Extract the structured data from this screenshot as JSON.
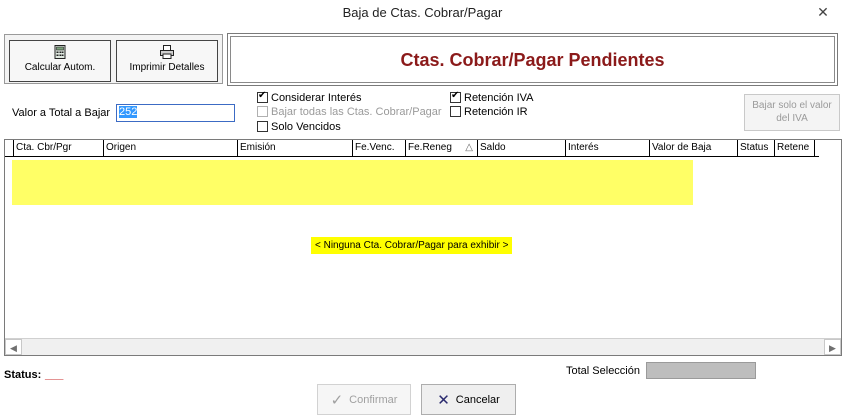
{
  "window": {
    "title": "Baja de Ctas. Cobrar/Pagar",
    "close_glyph": "✕"
  },
  "toolbar": {
    "calcular_label": "Calcular Autom.",
    "calcular_icon": "calculator-icon",
    "imprimir_label": "Imprimir Detalles",
    "imprimir_icon": "printer-icon"
  },
  "header": {
    "title": "Ctas. Cobrar/Pagar Pendientes",
    "title_color": "#8b1a1a"
  },
  "form": {
    "valor_label": "Valor a Total a Bajar",
    "valor_value": "252",
    "considerar_interes": {
      "label": "Considerar Interés",
      "checked": true
    },
    "bajar_todas": {
      "label": "Bajar todas las Ctas. Cobrar/Pagar",
      "checked": false,
      "enabled": false
    },
    "solo_vencidos": {
      "label": "Solo Vencidos",
      "checked": false
    },
    "retencion_iva": {
      "label": "Retención IVA",
      "checked": true
    },
    "retencion_ir": {
      "label": "Retención IR",
      "checked": false
    },
    "bajar_iva_label": "Bajar solo el valor del IVA"
  },
  "grid": {
    "columns": [
      "Cta. Cbr/Pgr",
      "Origen",
      "Emisión",
      "Fe.Venc.",
      "Fe.Reneg",
      "Saldo",
      "Interés",
      "Valor de Baja",
      "Status",
      "Retene"
    ],
    "sort_indicator": "△",
    "empty_message": "< Ninguna Cta. Cobrar/Pagar para exhibir >",
    "highlight_color": "#ffff66"
  },
  "footer": {
    "status_label": "Status:",
    "status_value": "___",
    "total_label": "Total Selección",
    "confirmar_label": "Confirmar",
    "cancelar_label": "Cancelar"
  }
}
